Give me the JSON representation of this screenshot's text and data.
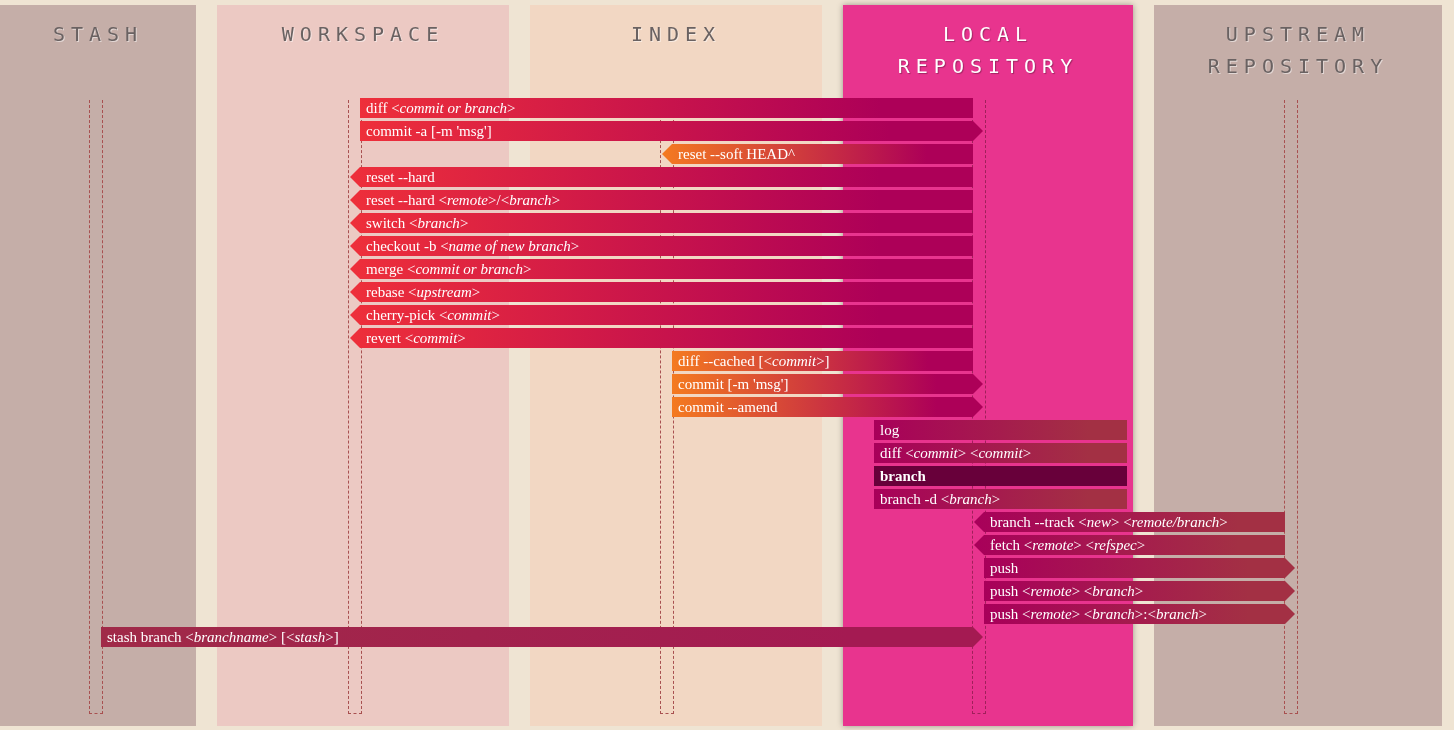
{
  "columns": [
    {
      "title": "STASH",
      "selected": false
    },
    {
      "title": "WORKSPACE",
      "selected": false
    },
    {
      "title": "INDEX",
      "selected": false
    },
    {
      "title": "LOCAL REPOSITORY",
      "selected": true
    },
    {
      "title": "UPSTREAM REPOSITORY",
      "selected": false
    }
  ],
  "commands": [
    {
      "text": "diff <*commit or branch*>",
      "kind": "workspace-compare",
      "selected": false
    },
    {
      "text": "commit -a [-m 'msg']",
      "kind": "workspace-commit",
      "selected": false
    },
    {
      "text": "reset --soft HEAD^",
      "kind": "index-reset",
      "selected": false
    },
    {
      "text": "reset --hard",
      "kind": "workspace-update",
      "selected": false
    },
    {
      "text": "reset --hard <*remote*>/<*branch*>",
      "kind": "workspace-update",
      "selected": false
    },
    {
      "text": "switch <*branch*>",
      "kind": "workspace-update",
      "selected": false
    },
    {
      "text": "checkout -b <*name of new branch*>",
      "kind": "workspace-update",
      "selected": false
    },
    {
      "text": "merge <*commit or branch*>",
      "kind": "workspace-update",
      "selected": false
    },
    {
      "text": "rebase <*upstream*>",
      "kind": "workspace-update",
      "selected": false
    },
    {
      "text": "cherry-pick <*commit*>",
      "kind": "workspace-update",
      "selected": false
    },
    {
      "text": "revert <*commit*>",
      "kind": "workspace-update",
      "selected": false
    },
    {
      "text": "diff --cached [<*commit*>]",
      "kind": "index-compare",
      "selected": false
    },
    {
      "text": "commit [-m 'msg']",
      "kind": "index-commit",
      "selected": false
    },
    {
      "text": "commit --amend",
      "kind": "index-commit",
      "selected": false
    },
    {
      "text": "log",
      "kind": "local-query",
      "selected": false
    },
    {
      "text": "diff <*commit*> <*commit*>",
      "kind": "local-query",
      "selected": false
    },
    {
      "text": "branch",
      "kind": "local-query",
      "selected": true
    },
    {
      "text": "branch -d <*branch*>",
      "kind": "local-query",
      "selected": false
    },
    {
      "text": "branch --track <*new*> <*remote/branch*>",
      "kind": "upstream-fetch",
      "selected": false
    },
    {
      "text": "fetch <*remote*> <*refspec*>",
      "kind": "upstream-fetch",
      "selected": false
    },
    {
      "text": "push",
      "kind": "upstream-push",
      "selected": false
    },
    {
      "text": "push <*remote*> <*branch*>",
      "kind": "upstream-push",
      "selected": false
    },
    {
      "text": "push <*remote*> <*branch*>:<*branch*>",
      "kind": "upstream-push",
      "selected": false
    },
    {
      "text": "stash branch <*branchname*> [<*stash*>]",
      "kind": "stash-apply",
      "selected": false
    }
  ]
}
